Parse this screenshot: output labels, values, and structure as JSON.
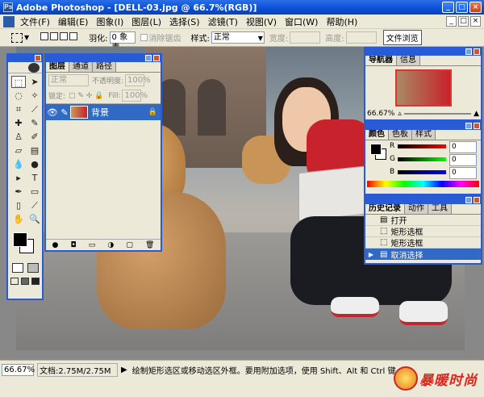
{
  "titlebar": {
    "title": "Adobe Photoshop - [DELL-03.jpg @ 66.7%(RGB)]",
    "min": "_",
    "max": "□",
    "close": "×"
  },
  "menu": [
    "文件(F)",
    "编辑(E)",
    "图象(I)",
    "图层(L)",
    "选择(S)",
    "滤镜(T)",
    "视图(V)",
    "窗口(W)",
    "帮助(H)"
  ],
  "doc_controls": {
    "min": "_",
    "max": "□",
    "close": "×"
  },
  "options": {
    "feather_label": "羽化:",
    "feather_value": "0 象素",
    "antialias_label": "消除锯齿",
    "style_label": "样式:",
    "style_value": "正常",
    "width_label": "宽度:",
    "height_label": "高度:",
    "browser_btn": "文件浏览"
  },
  "layers_panel": {
    "tabs": [
      "图层",
      "通道",
      "路径"
    ],
    "blend_mode": "正常",
    "opacity_label": "不透明度:",
    "opacity_value": "100%",
    "lock_label": "锁定:",
    "fill_label": "Fill:",
    "fill_value": "100%",
    "layer_name": "背景"
  },
  "navigator_panel": {
    "tabs": [
      "导航器",
      "信息"
    ],
    "zoom": "66.67%"
  },
  "color_panel": {
    "tabs": [
      "颜色",
      "色板",
      "样式"
    ],
    "r_label": "R",
    "g_label": "G",
    "b_label": "B",
    "r_value": "0",
    "g_value": "0",
    "b_value": "0"
  },
  "history_panel": {
    "tabs": [
      "历史记录",
      "动作",
      "工具"
    ],
    "items": [
      "打开",
      "矩形选框",
      "矩形选框",
      "取消选择"
    ]
  },
  "statusbar": {
    "zoom": "66.67%",
    "doc_size": "文档:2.75M/2.75M",
    "hint": "绘制矩形选区或移动选区外框。要用附加选项，使用 Shift、Alt 和 Ctrl 键。"
  },
  "watermark": {
    "text": "暴暖时尚"
  },
  "colors": {
    "xp_blue": "#2a5bd7",
    "fg": "#000000",
    "bg": "#ffffff"
  }
}
